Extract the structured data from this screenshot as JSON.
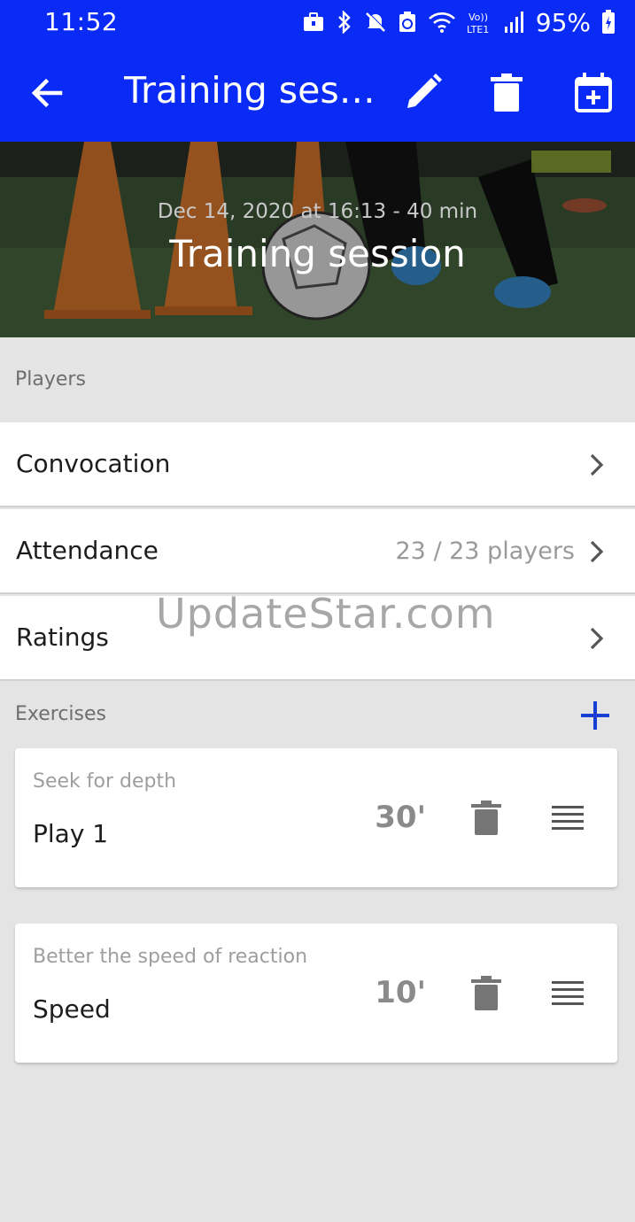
{
  "status_bar": {
    "time": "11:52",
    "battery": "95%",
    "icons": [
      "briefcase-icon",
      "bluetooth-icon",
      "mute-icon",
      "recycle-icon",
      "wifi-icon",
      "volte-icon",
      "signal-icon",
      "battery-icon"
    ]
  },
  "appbar": {
    "title": "Training ses…",
    "icons": [
      "back-arrow-icon",
      "edit-icon",
      "delete-icon",
      "calendar-add-icon"
    ],
    "color": "#0a2bf5"
  },
  "hero": {
    "date": "Dec 14, 2020 at 16:13 - 40 min",
    "title": "Training session"
  },
  "players": {
    "section_label": "Players",
    "rows": [
      {
        "label": "Convocation",
        "value": ""
      },
      {
        "label": "Attendance",
        "value": "23 / 23 players"
      },
      {
        "label": "Ratings",
        "value": ""
      }
    ]
  },
  "exercises": {
    "section_label": "Exercises",
    "add_icon": "plus-icon",
    "items": [
      {
        "subtitle": "Seek for depth",
        "name": "Play 1",
        "duration": "30'"
      },
      {
        "subtitle": "Better the speed of reaction",
        "name": "Speed",
        "duration": "10'"
      }
    ]
  },
  "watermark": "UpdateStar.com",
  "colors": {
    "accent": "#0a2bf5",
    "plus": "#1a3fd6",
    "background": "#e4e4e4"
  }
}
